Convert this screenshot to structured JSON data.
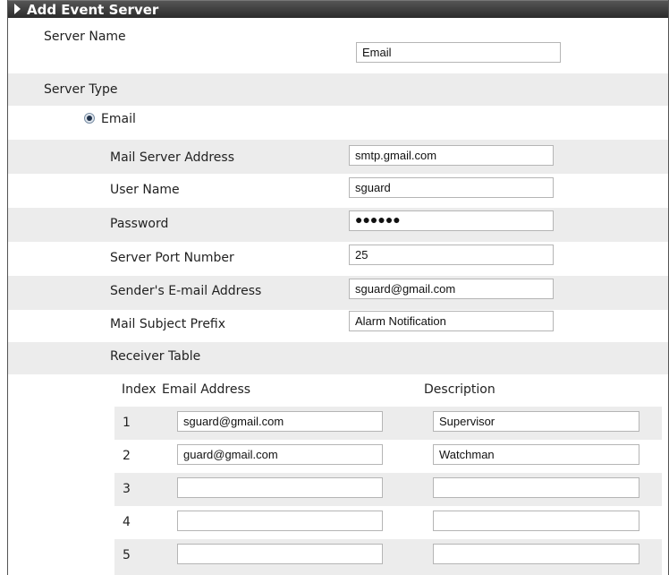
{
  "header": {
    "title": "Add Event Server"
  },
  "server_name": {
    "label": "Server Name",
    "value": "Email"
  },
  "server_type": {
    "label": "Server Type",
    "option": "Email",
    "selected": true
  },
  "mail": {
    "server_address": {
      "label": "Mail Server Address",
      "value": "smtp.gmail.com"
    },
    "user_name": {
      "label": "User Name",
      "value": "sguard"
    },
    "password": {
      "label": "Password",
      "value": "●●●●●●"
    },
    "port": {
      "label": "Server Port Number",
      "value": "25"
    },
    "sender": {
      "label": "Sender's E-mail Address",
      "value": "sguard@gmail.com"
    },
    "subject_prefix": {
      "label": "Mail Subject Prefix",
      "value": "Alarm Notification"
    }
  },
  "receiver_table": {
    "label": "Receiver Table",
    "headers": {
      "index": "Index",
      "email": "Email Address",
      "description": "Description"
    },
    "rows": [
      {
        "index": "1",
        "email": "sguard@gmail.com",
        "description": "Supervisor"
      },
      {
        "index": "2",
        "email": "guard@gmail.com",
        "description": "Watchman"
      },
      {
        "index": "3",
        "email": "",
        "description": ""
      },
      {
        "index": "4",
        "email": "",
        "description": ""
      },
      {
        "index": "5",
        "email": "",
        "description": ""
      }
    ]
  }
}
